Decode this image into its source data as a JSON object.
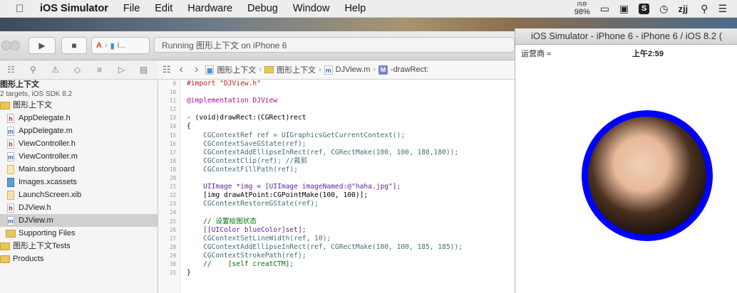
{
  "menubar": {
    "apple_icon": "apple-logo",
    "app_name": "iOS Simulator",
    "menus": [
      "File",
      "Edit",
      "Hardware",
      "Debug",
      "Window",
      "Help"
    ],
    "status": {
      "memory_label": "内存",
      "memory_value": "98%",
      "user": "zjj"
    }
  },
  "toolbar": {
    "scheme_target": "i...",
    "activity_text": "Running 图形上下文 on iPhone 6"
  },
  "navigator": {
    "project_name": "图形上下文",
    "project_subtitle": "2 targets, iOS SDK 8.2",
    "group_name": "图形上下文",
    "files": [
      {
        "name": "AppDelegate.h",
        "type": "h"
      },
      {
        "name": "AppDelegate.m",
        "type": "m"
      },
      {
        "name": "ViewController.h",
        "type": "h"
      },
      {
        "name": "ViewController.m",
        "type": "m"
      },
      {
        "name": "Main.storyboard",
        "type": "storyboard"
      },
      {
        "name": "Images.xcassets",
        "type": "xcassets"
      },
      {
        "name": "LaunchScreen.xib",
        "type": "xib"
      },
      {
        "name": "DJView.h",
        "type": "h"
      },
      {
        "name": "DJView.m",
        "type": "m"
      }
    ],
    "supporting_files": "Supporting Files",
    "tests_group": "图形上下文Tests",
    "products_group": "Products"
  },
  "jumpbar": {
    "crumbs": [
      "图形上下文",
      "图形上下文",
      "DJView.m",
      "-drawRect:"
    ]
  },
  "editor": {
    "line_numbers": [
      "9",
      "10",
      "11",
      "12",
      "13",
      "14",
      "15",
      "16",
      "17",
      "18",
      "19",
      "20",
      "21",
      "22",
      "23",
      "24",
      "25",
      "26",
      "27",
      "28",
      "29",
      "30",
      "31"
    ],
    "lines": [
      "#import \"DJView.h\"",
      "",
      "@implementation DJView",
      "",
      "- (void)drawRect:(CGRect)rect",
      "{",
      "    CGContextRef ref = UIGraphicsGetCurrentContext();",
      "    CGContextSaveGState(ref);",
      "    CGContextAddEllipseInRect(ref, CGRectMake(100, 100, 180,180));",
      "    CGContextClip(ref); //裁剪",
      "    CGContextFillPath(ref);",
      "",
      "    UIImage *img = [UIImage imageNamed:@\"haha.jpg\"];",
      "    [img drawAtPoint:CGPointMake(100, 100)];",
      "    CGContextRestoreGState(ref);",
      "",
      "    // 设置绘图状态",
      "    [[UIColor blueColor]set];",
      "    CGContextSetLineWidth(ref, 10);",
      "    CGContextAddEllipseInRect(ref, CGRectMake(100, 100, 185, 185));",
      "    CGContextStrokePath(ref);",
      "    //    [self creatCTM];",
      "}"
    ]
  },
  "simulator": {
    "window_title": "iOS Simulator - iPhone 6 - iPhone 6 / iOS 8.2 (",
    "carrier": "运营商",
    "time": "上午2:59",
    "ring_color": "#0000ff"
  }
}
